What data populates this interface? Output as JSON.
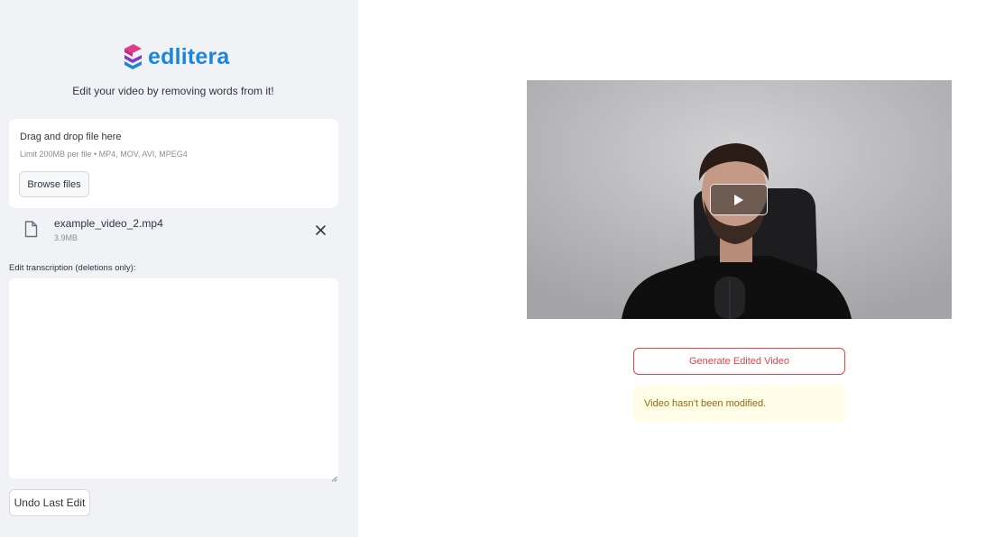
{
  "sidebar": {
    "logo": {
      "text": "edlitera",
      "icon": "layered-logo-icon"
    },
    "tagline": "Edit your video by removing words from it!",
    "uploader": {
      "title": "Drag and drop file here",
      "limit": "Limit 200MB per file • MP4, MOV, AVI, MPEG4",
      "browse_label": "Browse files"
    },
    "uploaded_file": {
      "name": "example_video_2.mp4",
      "size": "3.9MB",
      "icon": "file-icon",
      "remove_icon": "close-icon"
    },
    "transcription": {
      "label": "Edit transcription (deletions only):",
      "value": ""
    },
    "undo_label": "Undo Last Edit"
  },
  "main": {
    "video": {
      "play_icon": "play-icon"
    },
    "generate_label": "Generate Edited Video",
    "status_message": "Video hasn't been modified."
  },
  "colors": {
    "brand": "#1c87d9",
    "logo_magenta": "#e23a8a",
    "logo_purple": "#7b3fc4",
    "logo_blue": "#1c87d9",
    "primary_red": "#e0454c",
    "sidebar_bg": "#f0f2f6",
    "warning_bg": "#fffce7",
    "warning_text": "#926c05"
  }
}
